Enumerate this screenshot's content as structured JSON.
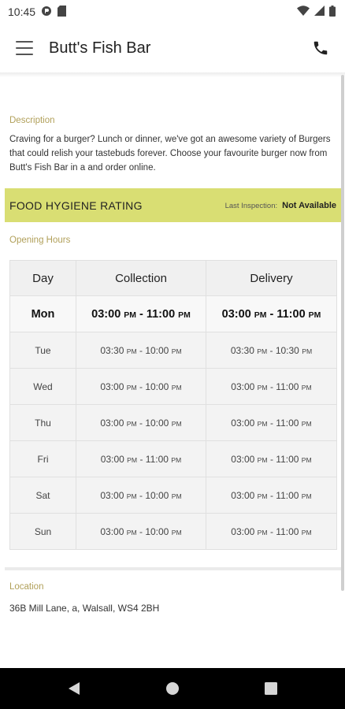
{
  "status_bar": {
    "time": "10:45",
    "icons": [
      "data-saver-icon",
      "sd-card-icon",
      "wifi-icon",
      "signal-icon",
      "battery-icon"
    ]
  },
  "app_bar": {
    "title": "Butt's Fish Bar",
    "icons": [
      "menu-icon",
      "phone-icon"
    ]
  },
  "description": {
    "label": "Description",
    "text": "Craving for a burger? Lunch or dinner, we've got an awesome variety of Burgers that could relish your tastebuds forever. Choose your favourite burger now from Butt's Fish Bar in a and order online."
  },
  "hygiene": {
    "title": "FOOD HYGIENE RATING",
    "last_inspection_label": "Last Inspection:",
    "last_inspection_value": "Not Available",
    "bar_color": "#d9de73"
  },
  "opening_hours": {
    "label": "Opening Hours",
    "headers": [
      "Day",
      "Collection",
      "Delivery"
    ],
    "rows": [
      {
        "day": "Mon",
        "col_start": "03:00",
        "col_start_ap": "PM",
        "col_end": "11:00",
        "col_end_ap": "PM",
        "del_start": "03:00",
        "del_start_ap": "PM",
        "del_end": "11:00",
        "del_end_ap": "PM"
      },
      {
        "day": "Tue",
        "col_start": "03:30",
        "col_start_ap": "PM",
        "col_end": "10:00",
        "col_end_ap": "PM",
        "del_start": "03:30",
        "del_start_ap": "PM",
        "del_end": "10:30",
        "del_end_ap": "PM"
      },
      {
        "day": "Wed",
        "col_start": "03:00",
        "col_start_ap": "PM",
        "col_end": "10:00",
        "col_end_ap": "PM",
        "del_start": "03:00",
        "del_start_ap": "PM",
        "del_end": "11:00",
        "del_end_ap": "PM"
      },
      {
        "day": "Thu",
        "col_start": "03:00",
        "col_start_ap": "PM",
        "col_end": "10:00",
        "col_end_ap": "PM",
        "del_start": "03:00",
        "del_start_ap": "PM",
        "del_end": "11:00",
        "del_end_ap": "PM"
      },
      {
        "day": "Fri",
        "col_start": "03:00",
        "col_start_ap": "PM",
        "col_end": "11:00",
        "col_end_ap": "PM",
        "del_start": "03:00",
        "del_start_ap": "PM",
        "del_end": "11:00",
        "del_end_ap": "PM"
      },
      {
        "day": "Sat",
        "col_start": "03:00",
        "col_start_ap": "PM",
        "col_end": "10:00",
        "col_end_ap": "PM",
        "del_start": "03:00",
        "del_start_ap": "PM",
        "del_end": "11:00",
        "del_end_ap": "PM"
      },
      {
        "day": "Sun",
        "col_start": "03:00",
        "col_start_ap": "PM",
        "col_end": "10:00",
        "col_end_ap": "PM",
        "del_start": "03:00",
        "del_start_ap": "PM",
        "del_end": "11:00",
        "del_end_ap": "PM"
      }
    ]
  },
  "location": {
    "label": "Location",
    "address": "36B Mill Lane, a, Walsall, WS4 2BH"
  },
  "nav_bar": {
    "icons": [
      "back-icon",
      "home-icon",
      "recents-icon"
    ]
  },
  "colors": {
    "accent_label": "#b1a05a",
    "hygiene_bar": "#d9de73"
  }
}
